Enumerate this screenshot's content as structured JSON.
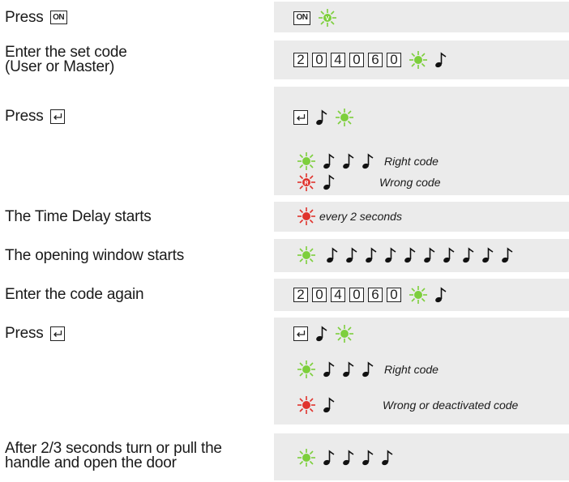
{
  "colors": {
    "green_led": "#7dcf3c",
    "red_led": "#e0332d",
    "panel": "#ebebeb"
  },
  "keys": {
    "on": "ON",
    "enter": "enter-key-icon"
  },
  "code": [
    "2",
    "0",
    "4",
    "0",
    "6",
    "0"
  ],
  "led_letters": {
    "green": "V",
    "red": "R"
  },
  "steps": [
    {
      "text": "Press"
    },
    {
      "text_line1": "Enter the set code",
      "text_line2": "(User or Master)"
    },
    {
      "text": "Press"
    },
    {
      "right_code": "Right code",
      "wrong_code": "Wrong code"
    },
    {
      "text": "The Time Delay starts",
      "caption": "every 2 seconds"
    },
    {
      "text": "The opening window starts"
    },
    {
      "text": "Enter the code again"
    },
    {
      "text": "Press"
    },
    {
      "right_code": "Right code",
      "wrong_code": "Wrong or deactivated code"
    },
    {
      "text_line1": "After 2/3 seconds turn or pull the",
      "text_line2": "handle and open the door"
    }
  ]
}
